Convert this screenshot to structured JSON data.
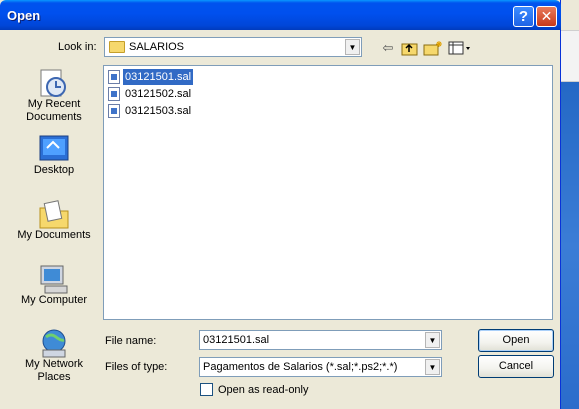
{
  "window": {
    "title": "Open"
  },
  "look_in": {
    "label": "Look in:",
    "value": "SALARIOS"
  },
  "places": [
    {
      "icon": "recent-documents-icon",
      "label": "My Recent Documents"
    },
    {
      "icon": "desktop-icon",
      "label": "Desktop"
    },
    {
      "icon": "my-documents-icon",
      "label": "My Documents"
    },
    {
      "icon": "my-computer-icon",
      "label": "My Computer"
    },
    {
      "icon": "my-network-places-icon",
      "label": "My Network Places"
    }
  ],
  "files": [
    {
      "name": "03121501.sal",
      "selected": true
    },
    {
      "name": "03121502.sal",
      "selected": false
    },
    {
      "name": "03121503.sal",
      "selected": false
    }
  ],
  "file_name": {
    "label": "File name:",
    "value": "03121501.sal"
  },
  "files_of_type": {
    "label": "Files of type:",
    "value": "Pagamentos de Salarios (*.sal;*.ps2;*.*)"
  },
  "read_only": {
    "label": "Open as read-only",
    "checked": false
  },
  "buttons": {
    "open": "Open",
    "cancel": "Cancel"
  }
}
